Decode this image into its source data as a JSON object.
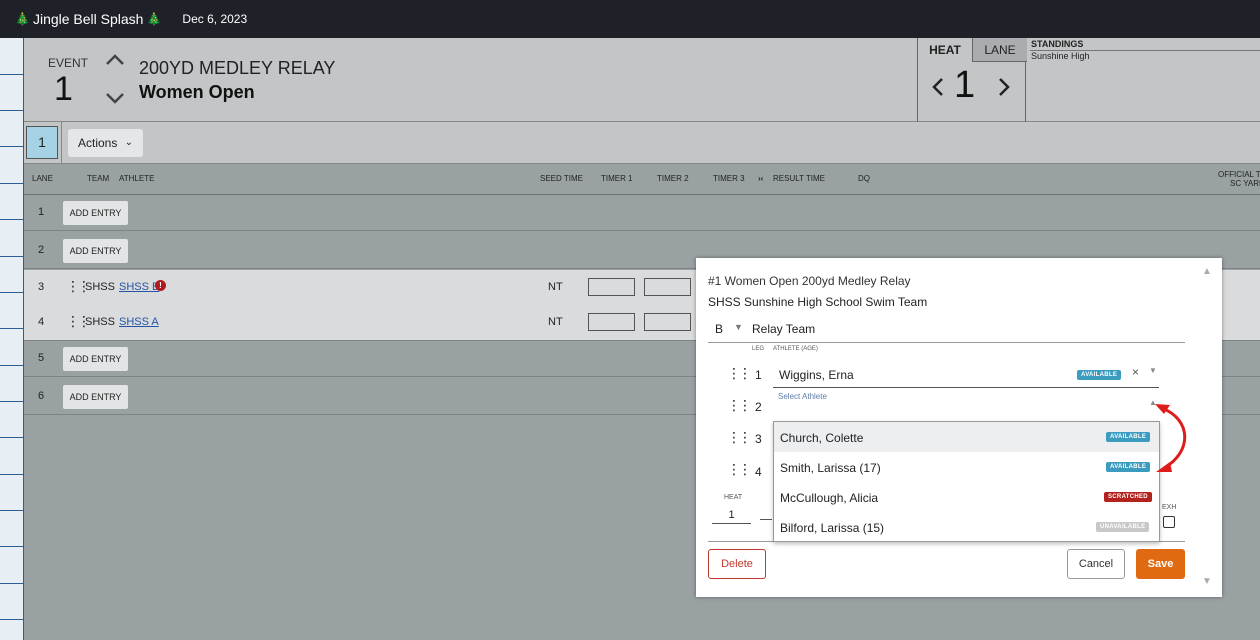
{
  "topbar": {
    "meet_title": "Jingle Bell Splash",
    "date": "Dec 6, 2023",
    "tree_glyph": "🎄"
  },
  "event": {
    "label": "EVENT",
    "number": "1",
    "name": "200YD MEDLEY RELAY",
    "subtitle": "Women Open"
  },
  "heat_panel": {
    "heat_tab": "HEAT",
    "lane_tab": "LANE",
    "heat_number": "1",
    "prev_icon": "chevron-left-icon",
    "next_icon": "chevron-right-icon"
  },
  "standings": {
    "title": "STANDINGS",
    "team": "Sunshine High"
  },
  "heat_tabs": {
    "current": "1",
    "actions_label": "Actions",
    "actions_caret": "⌄"
  },
  "columns": {
    "lane": "LANE",
    "team": "TEAM",
    "athlete": "ATHLETE",
    "seed_time": "SEED TIME",
    "timer1": "TIMER 1",
    "timer2": "TIMER 2",
    "timer3": "TIMER 3",
    "swap_glyph": "›‹",
    "result_time": "RESULT TIME",
    "dq": "DQ",
    "official": "OFFICIAL TIM",
    "course": "SC YARD"
  },
  "lanes": [
    {
      "lane": "1",
      "add_label": "ADD ENTRY"
    },
    {
      "lane": "2",
      "add_label": "ADD ENTRY"
    },
    {
      "lane": "3",
      "team": "SHSS",
      "athlete": "SHSS B",
      "seed": "NT",
      "warn": "!"
    },
    {
      "lane": "4",
      "team": "SHSS",
      "athlete": "SHSS A",
      "seed": "NT"
    },
    {
      "lane": "5",
      "add_label": "ADD ENTRY"
    },
    {
      "lane": "6",
      "add_label": "ADD ENTRY"
    }
  ],
  "modal": {
    "title": "#1 Women Open 200yd Medley Relay",
    "team": "SHSS Sunshine High School Swim Team",
    "relay_letter": "B",
    "relay_caret": "▼",
    "relay_label": "Relay Team",
    "col_leg": "LEG",
    "col_athlete": "ATHLETE (AGE)",
    "legs": [
      {
        "leg": "1",
        "athlete": "Wiggins, Erna",
        "status": "AVAILABLE"
      },
      {
        "leg": "2"
      },
      {
        "leg": "3"
      },
      {
        "leg": "4"
      }
    ],
    "clear_glyph": "×",
    "down_caret": "▼",
    "up_caret": "▲",
    "select_placeholder": "Select Athlete",
    "heat_label": "HEAT",
    "heat_value": "1",
    "exh_label": "EXH",
    "delete_label": "Delete",
    "cancel_label": "Cancel",
    "save_label": "Save"
  },
  "dropdown": [
    {
      "name": "Church, Colette",
      "status": "AVAILABLE",
      "kind": "available"
    },
    {
      "name": "Smith, Larissa (17)",
      "status": "AVAILABLE",
      "kind": "available"
    },
    {
      "name": "McCullough, Alicia",
      "status": "SCRATCHED",
      "kind": "scratched"
    },
    {
      "name": "Bilford, Larissa (15)",
      "status": "UNAVAILABLE",
      "kind": "unavailable"
    }
  ],
  "colors": {
    "accent_save": "#e06a12",
    "available": "#3b9cbf",
    "scratched": "#b3221c",
    "unavailable": "#c8c8c8",
    "annotation_arrow": "#e01b1b"
  }
}
